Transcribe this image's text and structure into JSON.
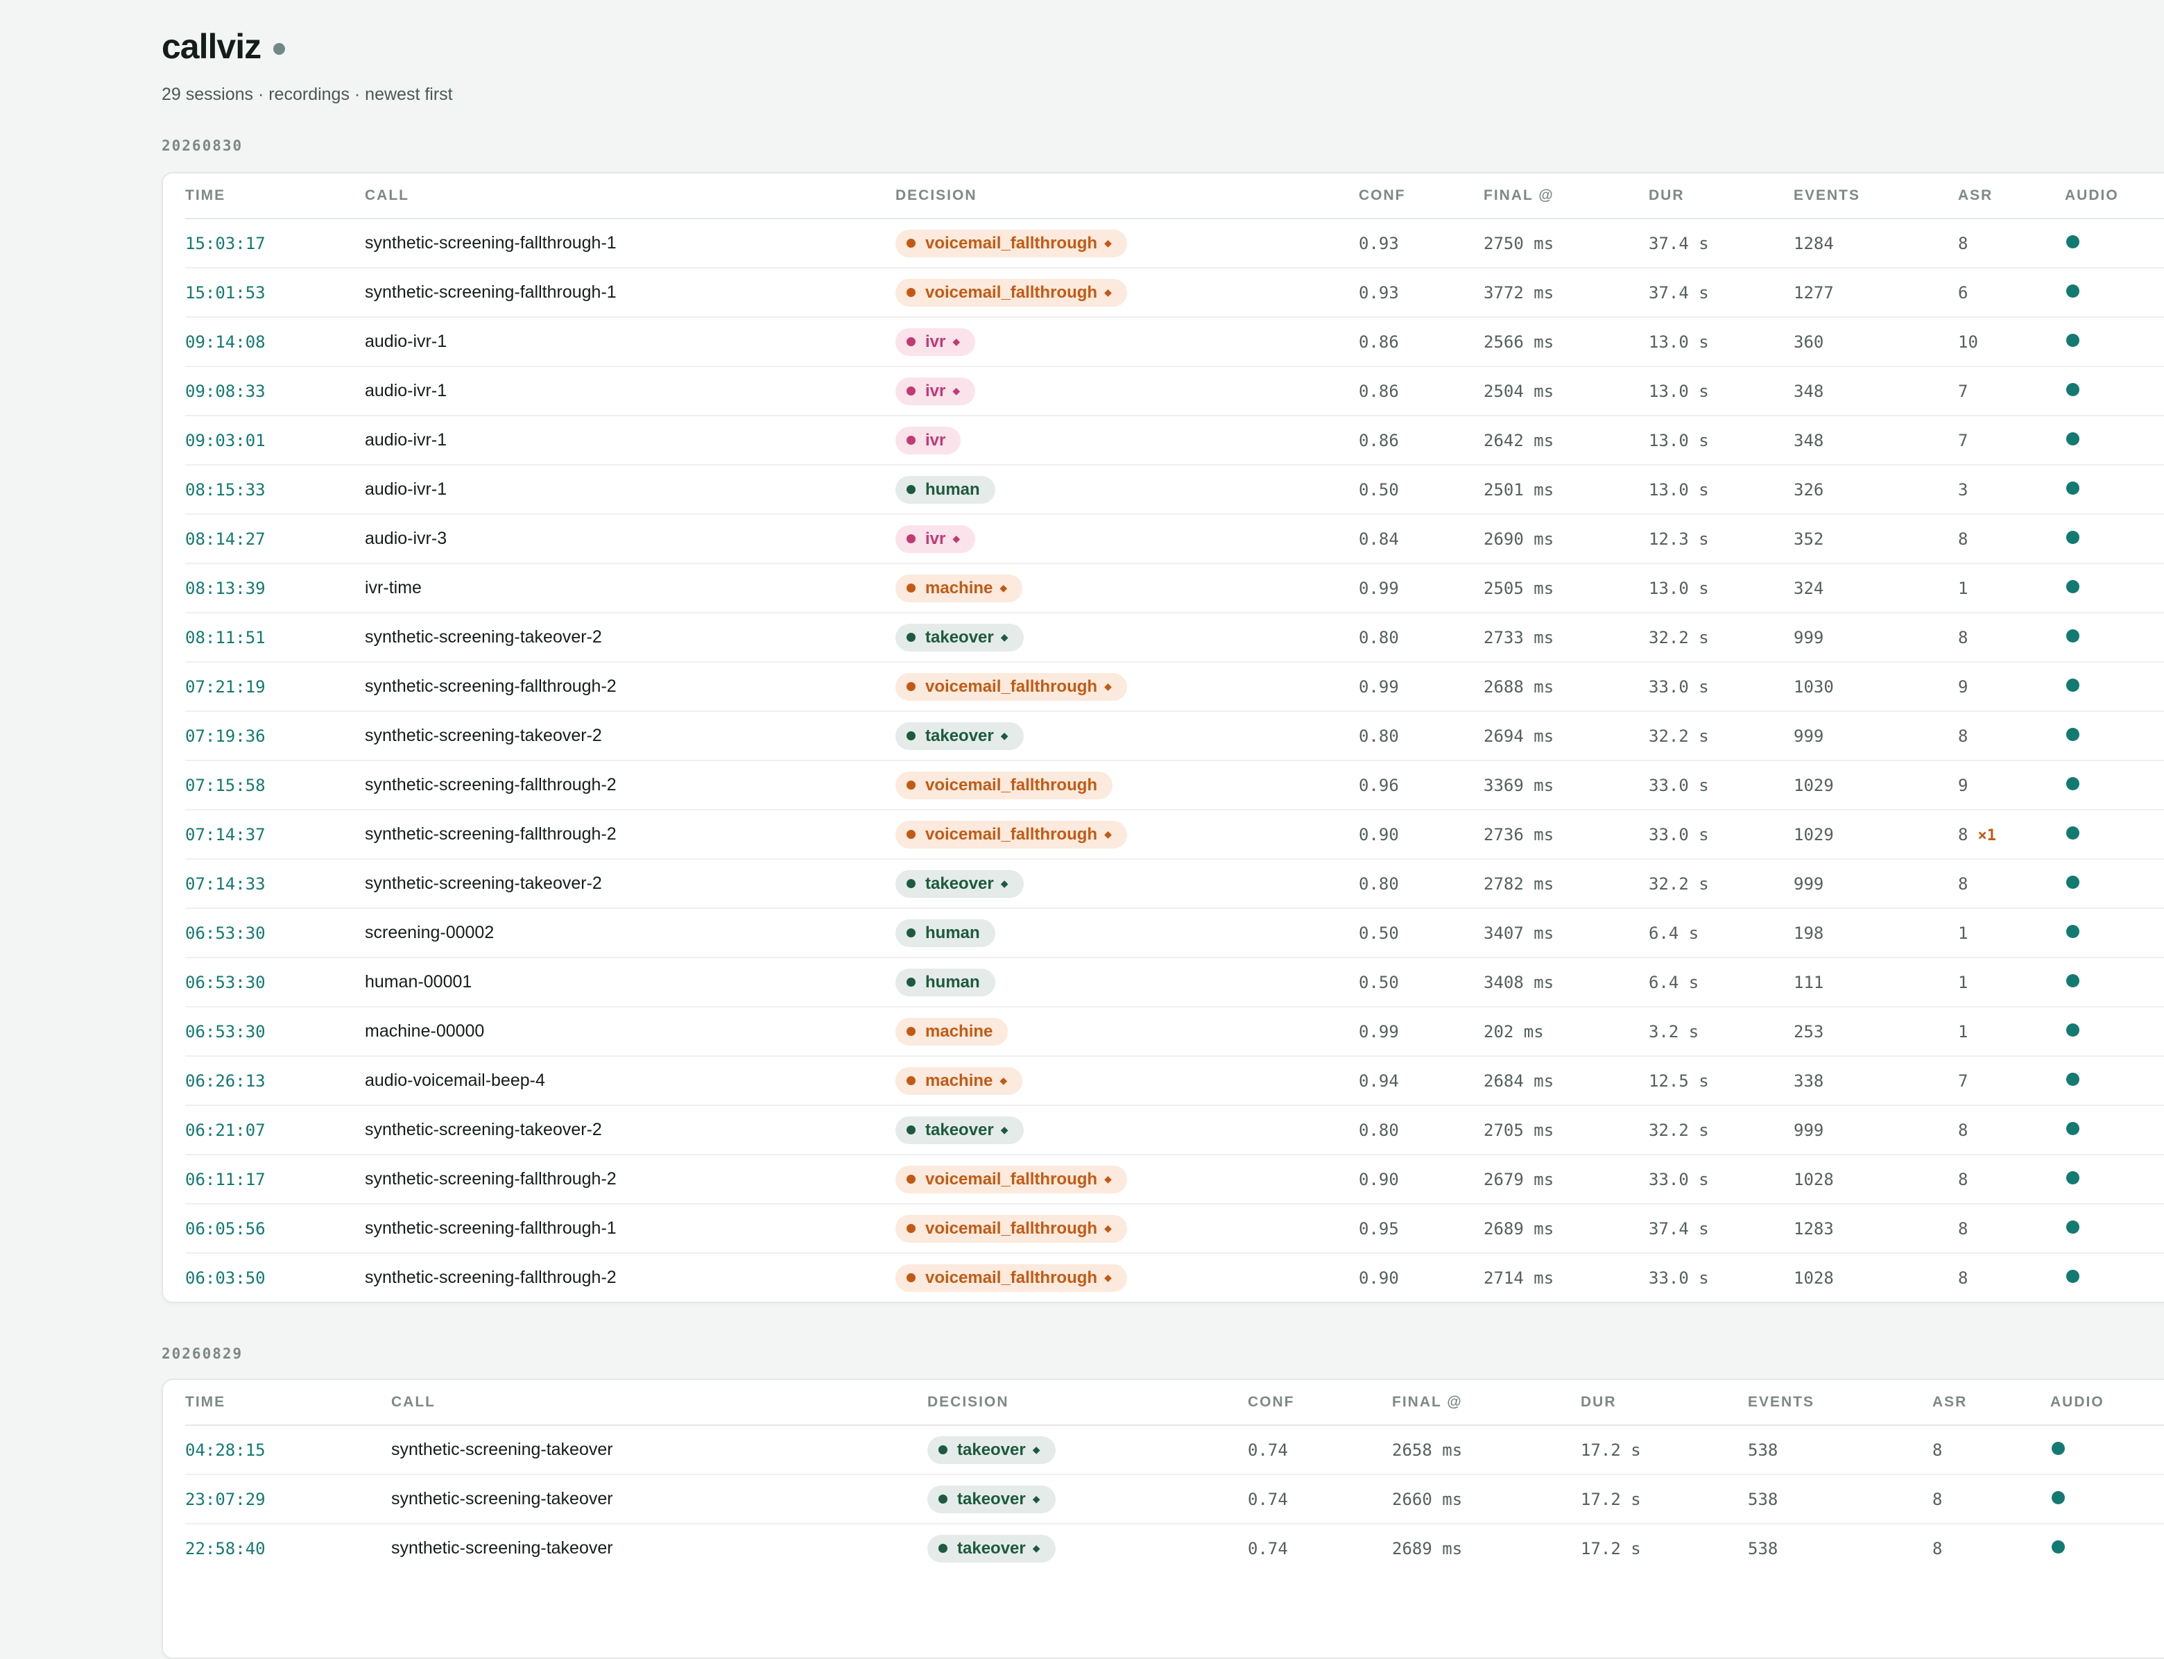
{
  "app": {
    "title": "callviz",
    "subtitle": "29 sessions · recordings · newest first"
  },
  "colors": {
    "accent": "#137a72",
    "orange": "#c35a14",
    "pink": "#c23a72",
    "green": "#1d5a3e",
    "background": "#f3f5f4"
  },
  "columns": {
    "time": "TIME",
    "call": "CALL",
    "decision": "DECISION",
    "conf": "CONF",
    "final": "FINAL @",
    "dur": "DUR",
    "events": "EVENTS",
    "asr": "ASR",
    "audio": "AUDIO"
  },
  "groups": [
    {
      "date": "20260830",
      "rows": [
        {
          "time": "15:03:17",
          "call": "synthetic-screening-fallthrough-1",
          "decision": "voicemail_fallthrough",
          "marker": "◆",
          "conf": "0.93",
          "final": "2750 ms",
          "dur": "37.4 s",
          "events": "1284",
          "asr": "8",
          "retry": ""
        },
        {
          "time": "15:01:53",
          "call": "synthetic-screening-fallthrough-1",
          "decision": "voicemail_fallthrough",
          "marker": "◆",
          "conf": "0.93",
          "final": "3772 ms",
          "dur": "37.4 s",
          "events": "1277",
          "asr": "6",
          "retry": ""
        },
        {
          "time": "09:14:08",
          "call": "audio-ivr-1",
          "decision": "ivr",
          "marker": "◆",
          "conf": "0.86",
          "final": "2566 ms",
          "dur": "13.0 s",
          "events": "360",
          "asr": "10",
          "retry": ""
        },
        {
          "time": "09:08:33",
          "call": "audio-ivr-1",
          "decision": "ivr",
          "marker": "◆",
          "conf": "0.86",
          "final": "2504 ms",
          "dur": "13.0 s",
          "events": "348",
          "asr": "7",
          "retry": ""
        },
        {
          "time": "09:03:01",
          "call": "audio-ivr-1",
          "decision": "ivr",
          "marker": "",
          "conf": "0.86",
          "final": "2642 ms",
          "dur": "13.0 s",
          "events": "348",
          "asr": "7",
          "retry": ""
        },
        {
          "time": "08:15:33",
          "call": "audio-ivr-1",
          "decision": "human",
          "marker": "",
          "conf": "0.50",
          "final": "2501 ms",
          "dur": "13.0 s",
          "events": "326",
          "asr": "3",
          "retry": ""
        },
        {
          "time": "08:14:27",
          "call": "audio-ivr-3",
          "decision": "ivr",
          "marker": "◆",
          "conf": "0.84",
          "final": "2690 ms",
          "dur": "12.3 s",
          "events": "352",
          "asr": "8",
          "retry": ""
        },
        {
          "time": "08:13:39",
          "call": "ivr-time",
          "decision": "machine",
          "marker": "◆",
          "conf": "0.99",
          "final": "2505 ms",
          "dur": "13.0 s",
          "events": "324",
          "asr": "1",
          "retry": ""
        },
        {
          "time": "08:11:51",
          "call": "synthetic-screening-takeover-2",
          "decision": "takeover",
          "marker": "◆",
          "conf": "0.80",
          "final": "2733 ms",
          "dur": "32.2 s",
          "events": "999",
          "asr": "8",
          "retry": ""
        },
        {
          "time": "07:21:19",
          "call": "synthetic-screening-fallthrough-2",
          "decision": "voicemail_fallthrough",
          "marker": "◆",
          "conf": "0.99",
          "final": "2688 ms",
          "dur": "33.0 s",
          "events": "1030",
          "asr": "9",
          "retry": ""
        },
        {
          "time": "07:19:36",
          "call": "synthetic-screening-takeover-2",
          "decision": "takeover",
          "marker": "◆",
          "conf": "0.80",
          "final": "2694 ms",
          "dur": "32.2 s",
          "events": "999",
          "asr": "8",
          "retry": ""
        },
        {
          "time": "07:15:58",
          "call": "synthetic-screening-fallthrough-2",
          "decision": "voicemail_fallthrough",
          "marker": "",
          "conf": "0.96",
          "final": "3369 ms",
          "dur": "33.0 s",
          "events": "1029",
          "asr": "9",
          "retry": ""
        },
        {
          "time": "07:14:37",
          "call": "synthetic-screening-fallthrough-2",
          "decision": "voicemail_fallthrough",
          "marker": "◆",
          "conf": "0.90",
          "final": "2736 ms",
          "dur": "33.0 s",
          "events": "1029",
          "asr": "8",
          "retry": "×1"
        },
        {
          "time": "07:14:33",
          "call": "synthetic-screening-takeover-2",
          "decision": "takeover",
          "marker": "◆",
          "conf": "0.80",
          "final": "2782 ms",
          "dur": "32.2 s",
          "events": "999",
          "asr": "8",
          "retry": ""
        },
        {
          "time": "06:53:30",
          "call": "screening-00002",
          "decision": "human",
          "marker": "",
          "conf": "0.50",
          "final": "3407 ms",
          "dur": "6.4 s",
          "events": "198",
          "asr": "1",
          "retry": ""
        },
        {
          "time": "06:53:30",
          "call": "human-00001",
          "decision": "human",
          "marker": "",
          "conf": "0.50",
          "final": "3408 ms",
          "dur": "6.4 s",
          "events": "111",
          "asr": "1",
          "retry": ""
        },
        {
          "time": "06:53:30",
          "call": "machine-00000",
          "decision": "machine",
          "marker": "",
          "conf": "0.99",
          "final": "202 ms",
          "dur": "3.2 s",
          "events": "253",
          "asr": "1",
          "retry": ""
        },
        {
          "time": "06:26:13",
          "call": "audio-voicemail-beep-4",
          "decision": "machine",
          "marker": "◆",
          "conf": "0.94",
          "final": "2684 ms",
          "dur": "12.5 s",
          "events": "338",
          "asr": "7",
          "retry": ""
        },
        {
          "time": "06:21:07",
          "call": "synthetic-screening-takeover-2",
          "decision": "takeover",
          "marker": "◆",
          "conf": "0.80",
          "final": "2705 ms",
          "dur": "32.2 s",
          "events": "999",
          "asr": "8",
          "retry": ""
        },
        {
          "time": "06:11:17",
          "call": "synthetic-screening-fallthrough-2",
          "decision": "voicemail_fallthrough",
          "marker": "◆",
          "conf": "0.90",
          "final": "2679 ms",
          "dur": "33.0 s",
          "events": "1028",
          "asr": "8",
          "retry": ""
        },
        {
          "time": "06:05:56",
          "call": "synthetic-screening-fallthrough-1",
          "decision": "voicemail_fallthrough",
          "marker": "◆",
          "conf": "0.95",
          "final": "2689 ms",
          "dur": "37.4 s",
          "events": "1283",
          "asr": "8",
          "retry": ""
        },
        {
          "time": "06:03:50",
          "call": "synthetic-screening-fallthrough-2",
          "decision": "voicemail_fallthrough",
          "marker": "◆",
          "conf": "0.90",
          "final": "2714 ms",
          "dur": "33.0 s",
          "events": "1028",
          "asr": "8",
          "retry": ""
        }
      ]
    },
    {
      "date": "20260829",
      "rows": [
        {
          "time": "04:28:15",
          "call": "synthetic-screening-takeover",
          "decision": "takeover",
          "marker": "◆",
          "conf": "0.74",
          "final": "2658 ms",
          "dur": "17.2 s",
          "events": "538",
          "asr": "8",
          "retry": ""
        },
        {
          "time": "23:07:29",
          "call": "synthetic-screening-takeover",
          "decision": "takeover",
          "marker": "◆",
          "conf": "0.74",
          "final": "2660 ms",
          "dur": "17.2 s",
          "events": "538",
          "asr": "8",
          "retry": ""
        },
        {
          "time": "22:58:40",
          "call": "synthetic-screening-takeover",
          "decision": "takeover",
          "marker": "◆",
          "conf": "0.74",
          "final": "2689 ms",
          "dur": "17.2 s",
          "events": "538",
          "asr": "8",
          "retry": ""
        }
      ]
    }
  ]
}
